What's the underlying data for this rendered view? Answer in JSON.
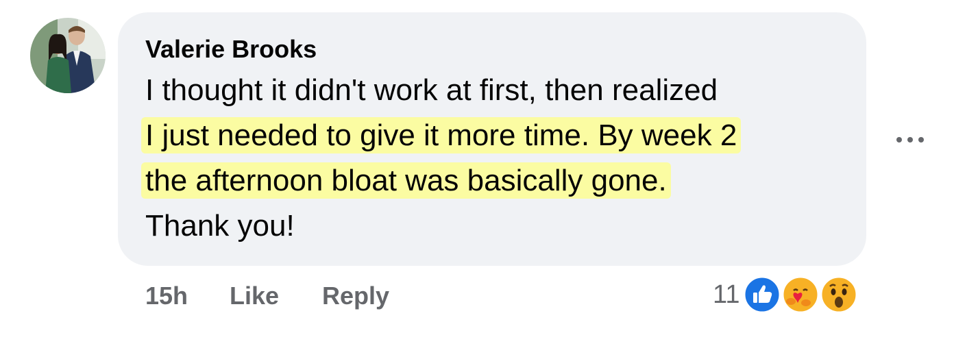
{
  "comment": {
    "author": "Valerie Brooks",
    "lines": [
      "I thought it didn't work at first, then realized",
      "I just needed to give it more time. By week 2",
      "the afternoon bloat was basically gone.",
      "Thank you!"
    ],
    "highlight_color": "#fbfca2",
    "bubble_color": "#f0f2f5"
  },
  "actions": {
    "time": "15h",
    "like": "Like",
    "reply": "Reply"
  },
  "reactions": {
    "count": "11",
    "icons": [
      "like-icon",
      "care-icon",
      "wow-icon"
    ]
  },
  "menu": {
    "icon": "more-options-icon"
  }
}
